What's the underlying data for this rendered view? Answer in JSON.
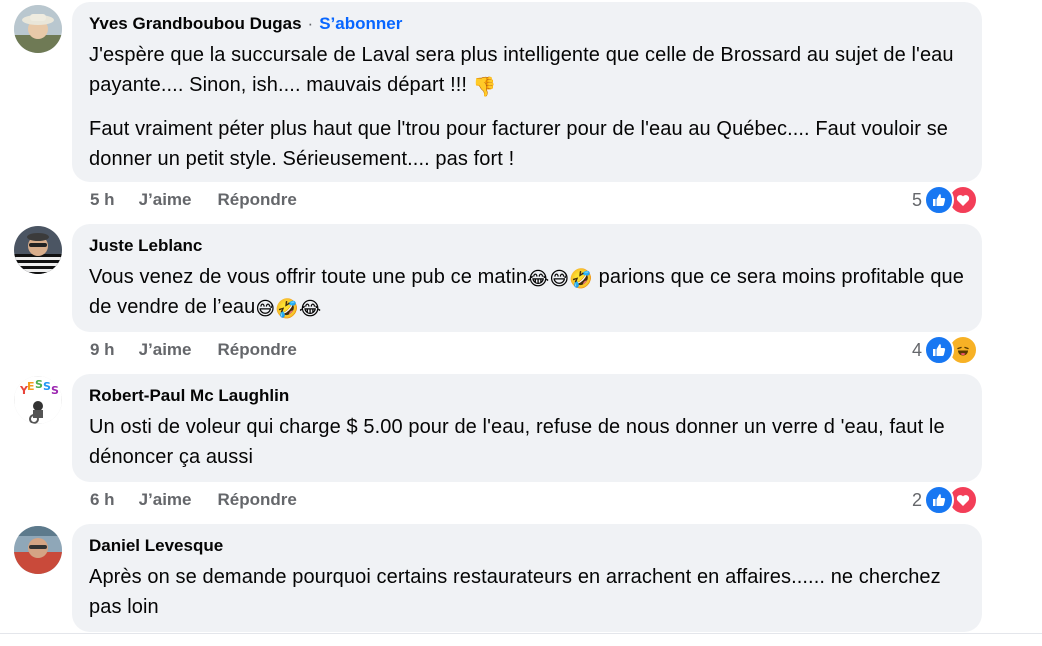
{
  "colors": {
    "bubble": "#f0f2f5",
    "accent": "#0866ff",
    "muted": "#65676b",
    "like": "#1877f2",
    "love": "#f33e58",
    "haha": "#f7b125"
  },
  "comments": [
    {
      "author": "Yves Grandboubou Dugas",
      "follow_label": "S’abonner",
      "paragraphs": [
        "J'espère que la succursale de Laval sera plus intelligente que celle de Brossard au sujet de l'eau payante.... Sinon, ish.... mauvais départ !!! ",
        "Faut vraiment péter plus haut que l'trou pour facturer pour de l'eau au Québec.... Faut vouloir se donner un petit style. Sérieusement.... pas fort !"
      ],
      "emoji": "👎",
      "time": "5 h",
      "like_label": "J’aime",
      "reply_label": "Répondre",
      "reaction_count": "5",
      "reactions": [
        "like-icon",
        "love-icon"
      ]
    },
    {
      "author": "Juste Leblanc",
      "text_a": "Vous venez de vous offrir toute une pub ce matin",
      "emoji_a": "😂😅🤣",
      "text_b": " parions que ce sera moins profitable que de vendre de l’eau",
      "emoji_b": "😅🤣😂",
      "time": "9 h",
      "like_label": "J’aime",
      "reply_label": "Répondre",
      "reaction_count": "4",
      "reactions": [
        "like-icon",
        "haha-icon"
      ]
    },
    {
      "author": "Robert-Paul Mc Laughlin",
      "text": "Un osti de voleur qui charge $ 5.00 pour de l'eau, refuse de nous donner un verre d 'eau, faut le dénoncer ça aussi",
      "time": "6 h",
      "like_label": "J’aime",
      "reply_label": "Répondre",
      "reaction_count": "2",
      "reactions": [
        "like-icon",
        "love-icon"
      ]
    },
    {
      "author": "Daniel Levesque",
      "text": "Après on se demande pourquoi certains restaurateurs en arrachent en affaires...... ne cherchez pas loin"
    }
  ]
}
